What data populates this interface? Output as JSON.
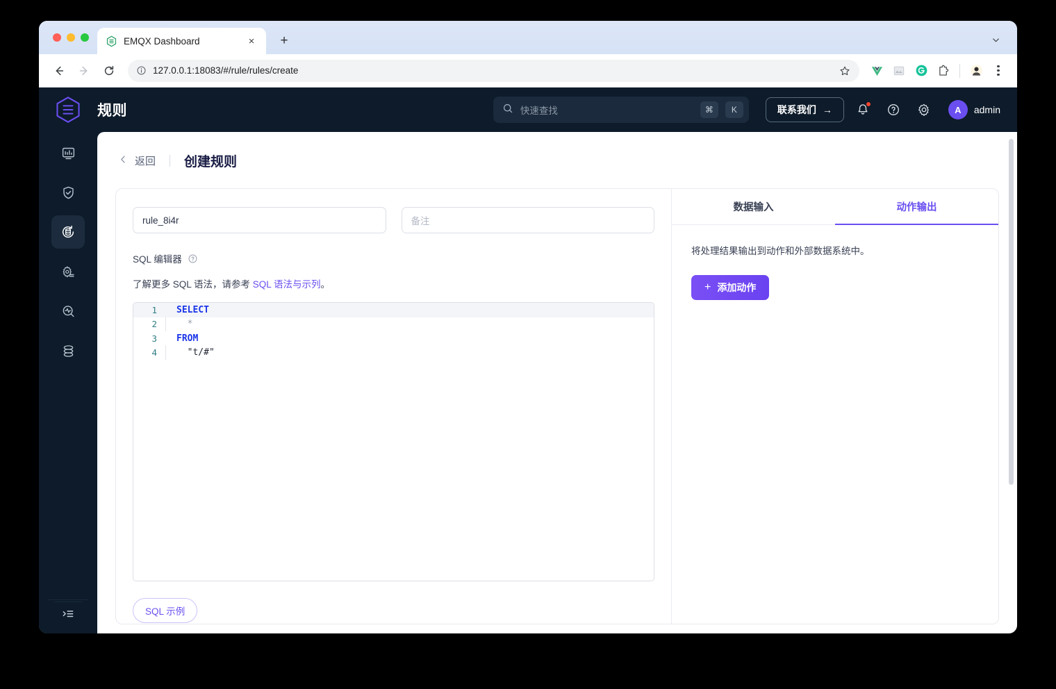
{
  "browser": {
    "tab": {
      "title": "EMQX Dashboard",
      "favicon": "emqx-favicon",
      "close": "×"
    },
    "newtab_label": "+",
    "window_chevron": "chevron-down-icon",
    "nav": {
      "back": "←",
      "forward": "→",
      "reload": "⟳"
    },
    "omnibox": {
      "url": "127.0.0.1:18083/#/rule/rules/create",
      "info_icon": "info-icon",
      "star_icon": "bookmark-star-icon"
    },
    "extensions": [
      "vue-devtools-icon",
      "image-extension-icon",
      "grammarly-icon",
      "puzzle-extensions-icon",
      "profile-avatar-icon"
    ],
    "menu_icon": "kebab-menu-icon"
  },
  "header": {
    "logo": "emqx-logo",
    "title": "规则",
    "search": {
      "placeholder": "快速查找",
      "icon": "search-icon",
      "shortcut_mod": "⌘",
      "shortcut_key": "K"
    },
    "contact_button": {
      "label": "联系我们",
      "arrow": "→"
    },
    "icons": [
      "bell-icon",
      "help-circle-icon",
      "gear-icon"
    ],
    "user": {
      "initial": "A",
      "name": "admin"
    }
  },
  "sidebar": {
    "items": [
      {
        "name": "dashboard",
        "icon": "monitor-chart-icon",
        "active": false
      },
      {
        "name": "access-control",
        "icon": "shield-check-icon",
        "active": false
      },
      {
        "name": "integration",
        "icon": "data-integration-icon",
        "active": true
      },
      {
        "name": "management",
        "icon": "gear-settings-icon",
        "active": false
      },
      {
        "name": "diagnose",
        "icon": "analytics-search-icon",
        "active": false
      },
      {
        "name": "system",
        "icon": "layers-stack-icon",
        "active": false
      }
    ],
    "collapse_icon": "sidebar-collapse-icon"
  },
  "page": {
    "back_label": "返回",
    "back_icon": "chevron-left-icon",
    "title": "创建规则"
  },
  "form": {
    "rule_name_value": "rule_8i4r",
    "remark_placeholder": "备注",
    "sql_editor_label": "SQL 编辑器",
    "help_icon": "question-circle-icon",
    "hint_prefix": "了解更多 SQL 语法，请参考 ",
    "hint_link": "SQL 语法与示列",
    "hint_suffix": "。",
    "sql_example_button": "SQL 示例"
  },
  "editor": {
    "lines": [
      {
        "num": "1",
        "tokens": [
          {
            "t": "SELECT",
            "c": "tok-kw"
          }
        ],
        "indent": false,
        "active": true
      },
      {
        "num": "2",
        "tokens": [
          {
            "t": "*",
            "c": "tok-star"
          }
        ],
        "indent": true,
        "active": false
      },
      {
        "num": "3",
        "tokens": [
          {
            "t": "FROM",
            "c": "tok-kw"
          }
        ],
        "indent": false,
        "active": false
      },
      {
        "num": "4",
        "tokens": [
          {
            "t": "\"t/#\"",
            "c": "tok-str"
          }
        ],
        "indent": true,
        "active": false
      }
    ]
  },
  "right_panel": {
    "tabs": [
      {
        "label": "数据输入",
        "active": false
      },
      {
        "label": "动作输出",
        "active": true
      }
    ],
    "description": "将处理结果输出到动作和外部数据系统中。",
    "add_action_button": {
      "plus": "+",
      "label": "添加动作"
    }
  },
  "colors": {
    "accent_purple": "#6a4ef0",
    "dark_navy": "#0d1b2a",
    "badge_red": "#f5452f",
    "keyword_blue": "#1a34e8"
  }
}
